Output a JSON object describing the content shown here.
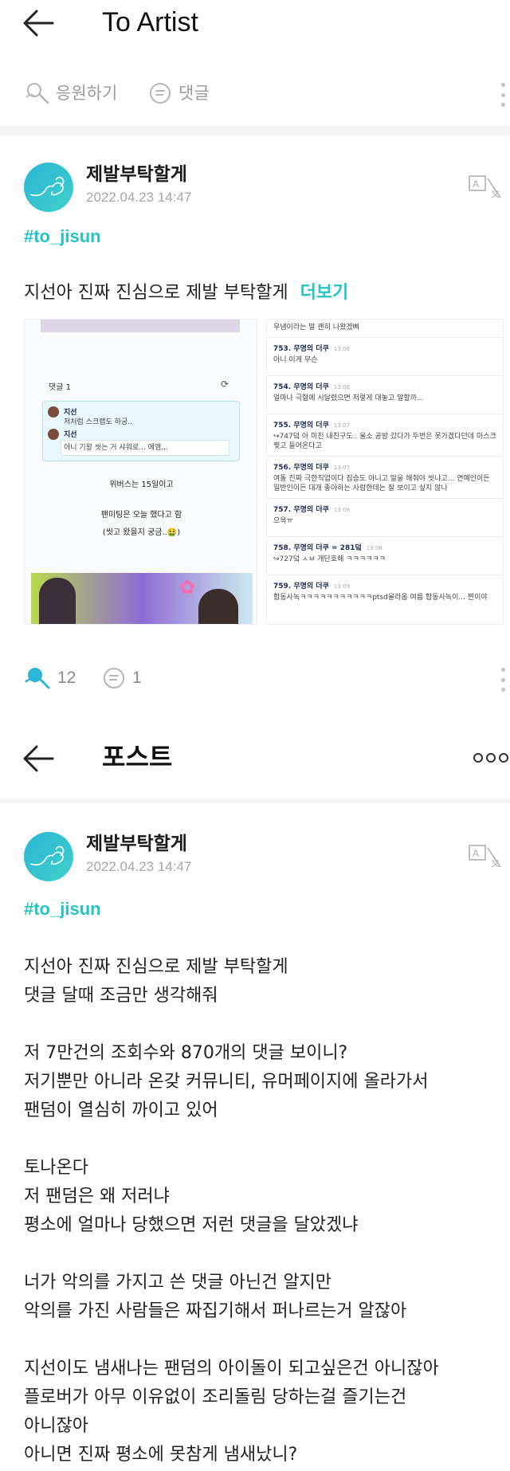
{
  "header1": {
    "title": "To Artist"
  },
  "actions": {
    "cheer_label": "응원하기",
    "comment_label": "댓글"
  },
  "post1": {
    "author": "제발부탁할게",
    "date": "2022.04.23 14:47",
    "tag": "#to_jisun",
    "preview_text": "지선아 진짜 진심으로 제발 부탁할게",
    "more_label": "더보기",
    "likes": "12",
    "comments": "1"
  },
  "screenshot_left": {
    "comment_header": "댓글 1",
    "c1_name": "지선",
    "c1_text": "저처럼 스크랩도 하궁..",
    "c2_name": "지선",
    "c2_text": "아니 기왕 씻는 거 샤워로... 에엠...",
    "line1": "위버스는 15일이고",
    "line2": "팬미팅은 오늘 했다고 함",
    "line3": "(씻고 왔을지 궁금..🤮)"
  },
  "screenshot_right": {
    "top_line": "우냄이라는 말 괜히 나왔겠삐",
    "items": [
      {
        "head": "753. 무명의 더쿠",
        "time": "13:06",
        "text": "아니 이게 무슨"
      },
      {
        "head": "754. 무명의 더쿠",
        "time": "13:06",
        "text": "얼마나 극혐에 시달렸으면 저렇게 대놓고 말할까..."
      },
      {
        "head": "755. 무명의 더쿠",
        "time": "13:07",
        "text": "↪747덬 아 미친 내친구도.. 울소 공방 갔다가 두번은 못가겠다던데 마스크 찢고 들어온다고"
      },
      {
        "head": "756. 무명의 더쿠",
        "time": "13:07",
        "text": "여돌 진짜 극한직업이다 짐승도 아니고 말을 해줘야 씻냐고... 연예인이든 일반인이든 대개 좋아하는 사람한테는 잘 보이고 싶지 않나"
      },
      {
        "head": "757. 무명의 더쿠",
        "time": "13:08",
        "text": "으윽ㅠ"
      },
      {
        "head": "758. 무명의 더쿠 = 281덬",
        "time": "13:08",
        "text": "↪727덬 ㅅㅂ 개단호해 ㅋㅋㅋㅋㅋㅋ"
      },
      {
        "head": "759. 무명의 더쿠",
        "time": "13:09",
        "text": "합동사녹ㅋㅋㅋㅋㅋㅋㅋㅋㅋㅋㅋptsd올라옴 여름 합동사녹이... 찐이야"
      }
    ]
  },
  "header2": {
    "title": "포스트"
  },
  "post2": {
    "author": "제발부탁할게",
    "date": "2022.04.23 14:47",
    "tag": "#to_jisun",
    "lines": [
      "지선아 진짜 진심으로 제발 부탁할게",
      "댓글 달때 조금만 생각해줘",
      "",
      "저 7만건의 조회수와 870개의 댓글 보이니?",
      "저기뿐만 아니라 온갖 커뮤니티, 유머페이지에 올라가서",
      "팬덤이 열심히 까이고 있어",
      "",
      "토나온다",
      "저 팬덤은 왜 저러냐",
      "평소에 얼마나 당했으면 저런 댓글을 달았겠냐",
      "",
      "너가 악의를 가지고 쓴 댓글 아닌건 알지만",
      "악의를 가진 사람들은 짜집기해서 퍼나르는거 알잖아",
      "",
      "지선이도 냄새나는 팬덤의 아이돌이 되고싶은건 아니잖아",
      "플로버가 아무 이유없이 조리돌림 당하는걸 즐기는건",
      "아니잖아",
      "아니면 진짜 평소에 못참게 냄새났니?"
    ]
  },
  "colors": {
    "accent": "#25c4c4",
    "avatar": "#2bb6d8",
    "muted": "#9a9a9a"
  }
}
